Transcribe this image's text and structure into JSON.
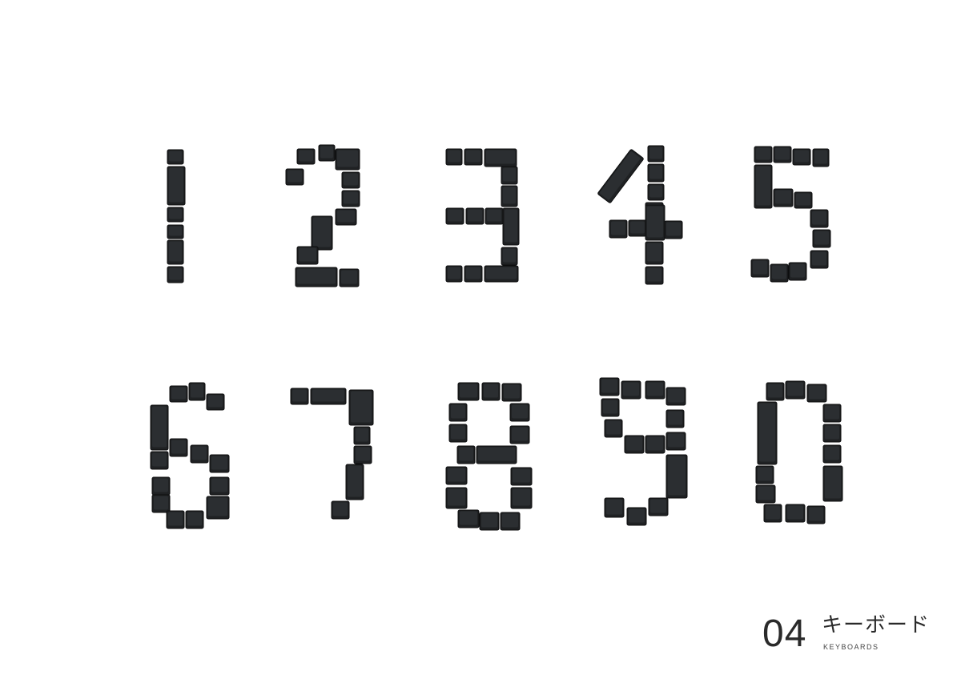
{
  "artwork": {
    "description_digits": [
      "1",
      "2",
      "3",
      "4",
      "5",
      "6",
      "7",
      "8",
      "9",
      "0"
    ],
    "key_color": "#1f2123",
    "background": "#ffffff"
  },
  "caption": {
    "number": "04",
    "title": "キーボード",
    "subtitle": "KEYBOARDS"
  }
}
